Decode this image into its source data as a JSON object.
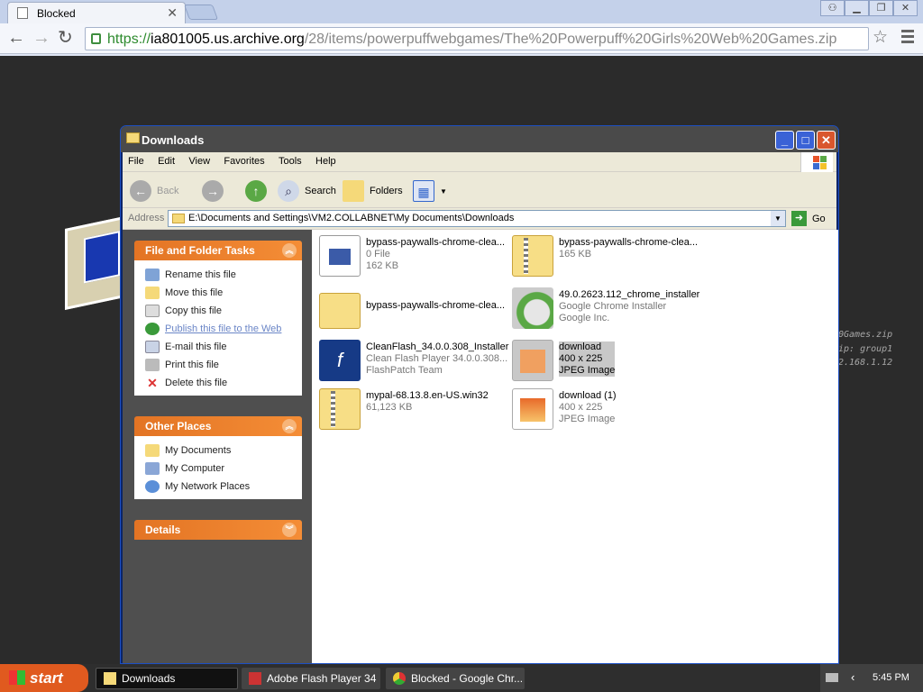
{
  "browser": {
    "tab_title": "Blocked",
    "url_scheme": "https://",
    "url_host": "ia801005.us.archive.org",
    "url_path": "/28/items/powerpuffwebgames/The%20Powerpuff%20Girls%20Web%20Games.zip"
  },
  "terminal_lines": [
    "0Games.zip",
    "ip: group1",
    "2.168.1.12"
  ],
  "explorer": {
    "title": "Downloads",
    "menu": [
      "File",
      "Edit",
      "View",
      "Favorites",
      "Tools",
      "Help"
    ],
    "toolbar": {
      "back": "Back",
      "search": "Search",
      "folders": "Folders"
    },
    "address_label": "Address",
    "address_path": "E:\\Documents and Settings\\VM2.COLLABNET\\My Documents\\Downloads",
    "go_label": "Go",
    "file_tasks": {
      "title": "File and Folder Tasks",
      "items": [
        "Rename this file",
        "Move this file",
        "Copy this file",
        "Publish this file to the Web",
        "E-mail this file",
        "Print this file",
        "Delete this file"
      ]
    },
    "other_places": {
      "title": "Other Places",
      "items": [
        "My Documents",
        "My Computer",
        "My Network Places"
      ]
    },
    "details": {
      "title": "Details"
    },
    "files": [
      {
        "name": "bypass-paywalls-chrome-clea...",
        "line2": "0 File",
        "line3": "162 KB"
      },
      {
        "name": "bypass-paywalls-chrome-clea...",
        "line2": "165 KB",
        "line3": ""
      },
      {
        "name": "bypass-paywalls-chrome-clea...",
        "line2": "",
        "line3": ""
      },
      {
        "name": "49.0.2623.112_chrome_installer",
        "line2": "Google Chrome Installer",
        "line3": "Google Inc."
      },
      {
        "name": "CleanFlash_34.0.0.308_Installer",
        "line2": "Clean Flash Player 34.0.0.308...",
        "line3": "FlashPatch Team"
      },
      {
        "name": "download",
        "line2": "400 x 225",
        "line3": "JPEG Image"
      },
      {
        "name": "mypal-68.13.8.en-US.win32",
        "line2": "61,123 KB",
        "line3": ""
      },
      {
        "name": "download (1)",
        "line2": "400 x 225",
        "line3": "JPEG Image"
      }
    ]
  },
  "taskbar": {
    "start": "start",
    "tasks": [
      "Downloads",
      "Adobe Flash Player 34",
      "Blocked - Google Chr..."
    ],
    "clock": "5:45 PM"
  }
}
